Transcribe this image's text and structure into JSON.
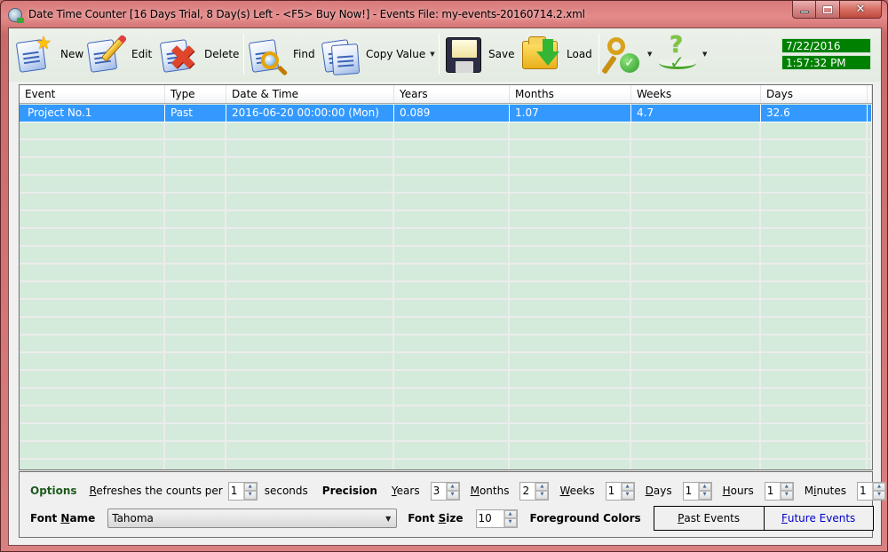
{
  "window": {
    "title": "Date Time Counter [16 Days Trial, 8 Day(s) Left  - <F5> Buy Now!] - Events File: my-events-20160714.2.xml",
    "controls": {
      "minimize": "minimize",
      "maximize": "maximize",
      "close": "✕"
    }
  },
  "toolbar": {
    "new_label": "New",
    "edit_label": "Edit",
    "delete_label": "Delete",
    "find_label": "Find",
    "copy_value_label": "Copy Value",
    "save_label": "Save",
    "load_label": "Load",
    "dropdown_arrow": "▼",
    "icons": [
      "new-document-star-icon",
      "edit-document-pencil-icon",
      "delete-document-x-icon",
      "find-document-magnifier-icon",
      "copy-documents-icon",
      "save-floppy-icon",
      "load-folder-arrow-icon",
      "key-check-icon",
      "help-book-question-icon"
    ]
  },
  "clock": {
    "date": "7/22/2016",
    "time": "1:57:32 PM",
    "bg_color": "#008000"
  },
  "grid": {
    "columns": [
      "Event",
      "Type",
      "Date & Time",
      "Years",
      "Months",
      "Weeks",
      "Days"
    ],
    "rows": [
      {
        "event": "Project No.1",
        "type": "Past",
        "datetime": "2016-06-20 00:00:00 (Mon)",
        "years": "0.089",
        "months": "1.07",
        "weeks": "4.7",
        "days": "32.6",
        "selected": true
      }
    ],
    "selected_color": "#3399ff",
    "row_bg_color": "#d4eadb"
  },
  "options": {
    "title": "Options",
    "refresh_label_pre": "efreshes the counts per",
    "refresh_label_mnemonic": "R",
    "refresh_value": "1",
    "refresh_unit": "seconds",
    "precision_label": "Precision",
    "precision": [
      {
        "mnemonic": "Y",
        "rest": "ears",
        "value": "3"
      },
      {
        "mnemonic": "M",
        "rest": "onths",
        "value": "2"
      },
      {
        "mnemonic": "W",
        "rest": "eeks",
        "value": "1"
      },
      {
        "mnemonic": "D",
        "rest": "ays",
        "value": "1"
      },
      {
        "mnemonic": "H",
        "rest": "ours",
        "value": "1"
      },
      {
        "pre": "M",
        "mnemonic": "i",
        "rest": "nutes",
        "value": "1"
      }
    ],
    "font_name_label_pre": "Font ",
    "font_name_mnemonic": "N",
    "font_name_label_post": "ame",
    "font_name_value": "Tahoma",
    "font_size_label_pre": "Font ",
    "font_size_mnemonic": "S",
    "font_size_label_post": "ize",
    "font_size_value": "10",
    "foreground_colors_label": "Foreground Colors",
    "past_events_mnemonic": "P",
    "past_events_rest": "ast Events",
    "future_events_mnemonic": "F",
    "future_events_rest": "uture Events"
  }
}
